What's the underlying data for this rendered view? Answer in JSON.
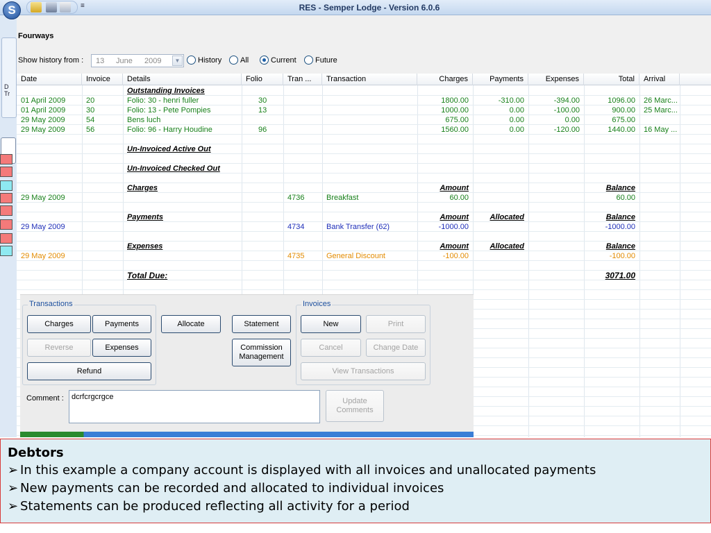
{
  "window": {
    "title": "RES - Semper Lodge - Version 6.0.6",
    "app_logo_letter": "S",
    "quick_access_more": "≡"
  },
  "background_app": {
    "ribbon_label_line1": "D",
    "ribbon_label_line2": "Tr",
    "swatches": [
      "#f47a7a",
      "#f47a7a",
      "#8ee9f1",
      "#f47a7a",
      "#f47a7a",
      "#f47a7a",
      "#f47a7a",
      "#8ee9f1"
    ]
  },
  "header": {
    "company_name": "Fourways",
    "history_label": "Show history from :",
    "date": {
      "day": "13",
      "month": "June",
      "year": "2009"
    },
    "filters": [
      {
        "label": "History",
        "selected": false
      },
      {
        "label": "All",
        "selected": false
      },
      {
        "label": "Current",
        "selected": true
      },
      {
        "label": "Future",
        "selected": false
      }
    ]
  },
  "grid": {
    "columns": [
      "Date",
      "Invoice",
      "Details",
      "Folio",
      "Tran ...",
      "Transaction",
      "Charges",
      "Payments",
      "Expenses",
      "Total",
      "Arrival"
    ],
    "sections": {
      "outstanding": "Outstanding Invoices",
      "uninvoiced_active": "Un-Invoiced Active Out",
      "uninvoiced_checked": "Un-Invoiced Checked Out",
      "charges": "Charges",
      "payments": "Payments",
      "expenses": "Expenses",
      "total_due": "Total Due:"
    },
    "invoices": [
      {
        "date": "01 April 2009",
        "invoice": "20",
        "details": "Folio: 30 - henri fuller",
        "folio": "30",
        "charges": "1800.00",
        "payments": "-310.00",
        "expenses": "-394.00",
        "total": "1096.00",
        "arrival": "26 Marc..."
      },
      {
        "date": "01 April 2009",
        "invoice": "30",
        "details": "Folio: 13 - Pete Pompies",
        "folio": "13",
        "charges": "1000.00",
        "payments": "0.00",
        "expenses": "-100.00",
        "total": "900.00",
        "arrival": "25 Marc..."
      },
      {
        "date": "29 May 2009",
        "invoice": "54",
        "details": "Bens luch",
        "folio": "",
        "charges": "675.00",
        "payments": "0.00",
        "expenses": "0.00",
        "total": "675.00",
        "arrival": ""
      },
      {
        "date": "29 May 2009",
        "invoice": "56",
        "details": "Folio: 96 - Harry Houdine",
        "folio": "96",
        "charges": "1560.00",
        "payments": "0.00",
        "expenses": "-120.00",
        "total": "1440.00",
        "arrival": "16 May ..."
      }
    ],
    "headers": {
      "amount": "Amount",
      "allocated": "Allocated",
      "balance": "Balance"
    },
    "charge_row": {
      "date": "29 May 2009",
      "tran": "4736",
      "transaction": "Breakfast",
      "amount": "60.00",
      "balance": "60.00"
    },
    "payment_row": {
      "date": "29 May 2009",
      "tran": "4734",
      "transaction": "Bank Transfer (62)",
      "amount": "-1000.00",
      "balance": "-1000.00"
    },
    "expense_row": {
      "date": "29 May 2009",
      "tran": "4735",
      "transaction": "General Discount",
      "amount": "-100.00",
      "balance": "-100.00"
    },
    "total_due": "3071.00"
  },
  "transactions_panel": {
    "group_title": "Transactions",
    "charges": "Charges",
    "payments": "Payments",
    "allocate": "Allocate",
    "statement": "Statement",
    "reverse": "Reverse",
    "expenses": "Expenses",
    "commission": "Commission Management",
    "refund": "Refund"
  },
  "invoices_panel": {
    "group_title": "Invoices",
    "new": "New",
    "print": "Print",
    "cancel": "Cancel",
    "change_date": "Change Date",
    "view_transactions": "View Transactions"
  },
  "comment": {
    "label": "Comment :",
    "value": "dcrfcrgcrgce",
    "update_button": "Update Comments"
  },
  "caption": {
    "title": "Debtors",
    "bullet": "➢",
    "lines": [
      "In this example a company account is displayed with all invoices and unallocated payments",
      "New payments can be recorded and allocated to individual invoices",
      "Statements can be produced reflecting all activity for a period"
    ]
  },
  "colors": {
    "invoice_text": "#18801b",
    "payment_text": "#1f2fb9",
    "expense_text": "#e38b00"
  }
}
